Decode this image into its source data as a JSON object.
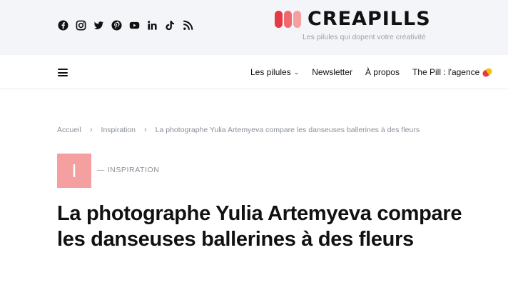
{
  "topbar": {
    "socials": [
      {
        "icon": "facebook-icon"
      },
      {
        "icon": "instagram-icon"
      },
      {
        "icon": "twitter-icon"
      },
      {
        "icon": "pinterest-icon"
      },
      {
        "icon": "youtube-icon"
      },
      {
        "icon": "linkedin-icon"
      },
      {
        "icon": "tiktok-icon"
      },
      {
        "icon": "rss-icon"
      }
    ],
    "logo_text": "CREAPILLS",
    "tagline": "Les pilules qui dopent votre créativité"
  },
  "nav": {
    "menu_icon": "hamburger-icon",
    "items": [
      {
        "label": "Les pilules"
      },
      {
        "label": "Newsletter"
      },
      {
        "label": "À propos"
      },
      {
        "label": "The Pill : l'agence"
      }
    ]
  },
  "breadcrumb": {
    "items": [
      "Accueil",
      "Inspiration",
      "La photographe Yulia Artemyeva compare les danseuses ballerines à des fleurs"
    ]
  },
  "category": {
    "letter": "I",
    "label": "— INSPIRATION"
  },
  "article": {
    "title": "La photographe Yulia Artemyeva compare les danseuses ballerines à des fleurs"
  },
  "colors": {
    "topbar_bg": "#f4f5f8",
    "accent_red": "#e63946",
    "accent_pink": "#f4a0a0",
    "muted_text": "#8a8f98"
  }
}
